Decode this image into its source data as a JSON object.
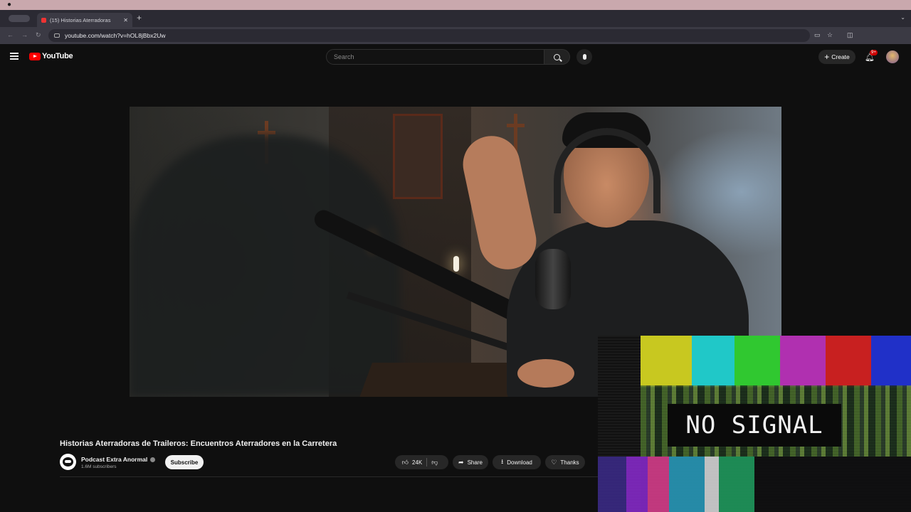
{
  "browser": {
    "tab_title": "(15) Historias Aterradoras",
    "url": "youtube.com/watch?v=hOL8jBbx2Uw"
  },
  "youtube": {
    "logo_text": "YouTube",
    "search_placeholder": "Search",
    "create_label": "Create",
    "notification_badge": "9+"
  },
  "video": {
    "title": "Historias Aterradoras de Traileros: Encuentros Aterradores en la Carretera",
    "channel_name": "Podcast Extra Anormal",
    "subscribers": "1.6M subscribers",
    "subscribe_label": "Subscribe",
    "likes": "24K",
    "share_label": "Share",
    "download_label": "Download",
    "thanks_label": "Thanks"
  },
  "overlay": {
    "text": "NO SIGNAL"
  },
  "icons": [
    "apple-icon",
    "youtube-favicon",
    "close-icon",
    "plus-icon",
    "back-icon",
    "forward-icon",
    "reload-icon",
    "site-info-icon",
    "cast-icon",
    "star-icon",
    "extensions-icon",
    "menu-icon",
    "search-icon",
    "mic-icon",
    "bell-icon",
    "like-icon",
    "dislike-icon",
    "share-icon",
    "download-icon",
    "thanks-icon"
  ],
  "colors": {
    "brand_red": "#ff0000",
    "background": "#0f0f0f",
    "badge_red": "#cc0000"
  }
}
